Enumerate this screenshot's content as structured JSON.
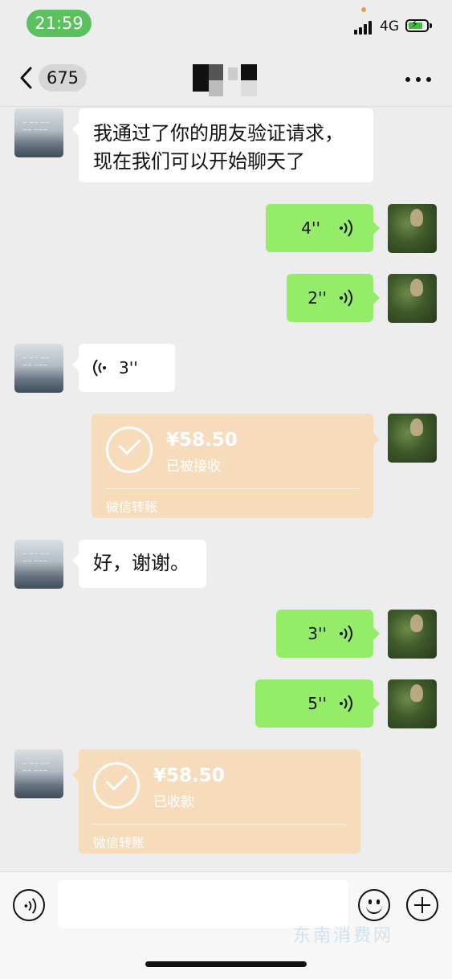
{
  "status_bar": {
    "time": "21:59",
    "network": "4G",
    "colors": {
      "time_pill": "#5ac15e",
      "battery_fill": "#3cbf3c"
    }
  },
  "nav": {
    "unread_count": "675",
    "icons": {
      "back": "chevron-left-icon",
      "more": "more-dots-icon"
    }
  },
  "messages": {
    "m1": {
      "sender": "other",
      "type": "text",
      "text_line1": "我通过了你的朋友验证请求，",
      "text_line2": "现在我们可以开始聊天了"
    },
    "m2": {
      "sender": "me",
      "type": "voice",
      "duration": "4''"
    },
    "m3": {
      "sender": "me",
      "type": "voice",
      "duration": "2''"
    },
    "m4": {
      "sender": "other",
      "type": "voice",
      "duration": "3''"
    },
    "m5": {
      "sender": "me",
      "type": "transfer",
      "amount": "¥58.50",
      "status": "已被接收",
      "footer": "微信转账"
    },
    "m6": {
      "sender": "other",
      "type": "text",
      "text": "好，谢谢。"
    },
    "m7": {
      "sender": "me",
      "type": "voice",
      "duration": "3''"
    },
    "m8": {
      "sender": "me",
      "type": "voice",
      "duration": "5''"
    },
    "m9": {
      "sender": "other",
      "type": "transfer",
      "amount": "¥58.50",
      "status": "已收款",
      "footer": "微信转账"
    }
  },
  "colors": {
    "background": "#ededed",
    "bubble_mine": "#95ec69",
    "bubble_other": "#ffffff",
    "transfer_bg": "#f6dcbb"
  },
  "input_bar": {
    "icons": {
      "voice": "voice-mode-icon",
      "emoji": "emoji-icon",
      "plus": "plus-icon"
    },
    "text_value": ""
  },
  "watermark": "东南消费网"
}
